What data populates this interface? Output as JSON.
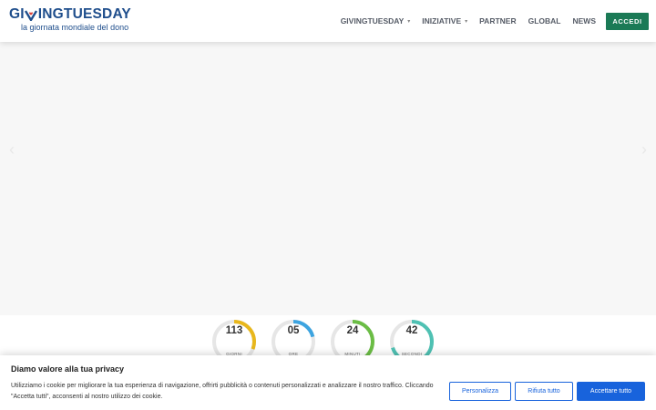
{
  "header": {
    "logo_text_1": "GI",
    "logo_text_2": "INGTUESDAY",
    "logo_subtitle": "la giornata mondiale del dono",
    "nav": [
      {
        "label": "GIVINGTUESDAY",
        "has_dropdown": true
      },
      {
        "label": "INIZIATIVE",
        "has_dropdown": true
      },
      {
        "label": "PARTNER",
        "has_dropdown": false
      },
      {
        "label": "GLOBAL",
        "has_dropdown": false
      },
      {
        "label": "NEWS",
        "has_dropdown": false
      }
    ],
    "caret": "▾",
    "login_label": "ACCEDI"
  },
  "slider": {
    "prev": "‹",
    "next": "›"
  },
  "countdown": [
    {
      "value": "113",
      "label": "GIORNI",
      "color": "#e8b71c",
      "fraction": 0.31
    },
    {
      "value": "05",
      "label": "ORE",
      "color": "#3da4e0",
      "fraction": 0.21
    },
    {
      "value": "24",
      "label": "MINUTI",
      "color": "#6bbd45",
      "fraction": 0.4
    },
    {
      "value": "42",
      "label": "SECONDI",
      "color": "#4fc1b3",
      "fraction": 0.7
    }
  ],
  "cookie": {
    "title": "Diamo valore alla tua privacy",
    "text": "Utilizziamo i cookie per migliorare la tua esperienza di navigazione, offrirti pubblicità o contenuti personalizzati e analizzare il nostro traffico. Cliccando \"Accetta tutti\", acconsenti al nostro utilizzo dei cookie.",
    "customize_label": "Personalizza",
    "reject_label": "Rifiuta tutto",
    "accept_label": "Accettare tutto"
  },
  "colors": {
    "brand_blue": "#1f4e8c",
    "logo_red": "#d9413a",
    "login_green": "#1b7a56",
    "cookie_blue": "#1863dc"
  }
}
